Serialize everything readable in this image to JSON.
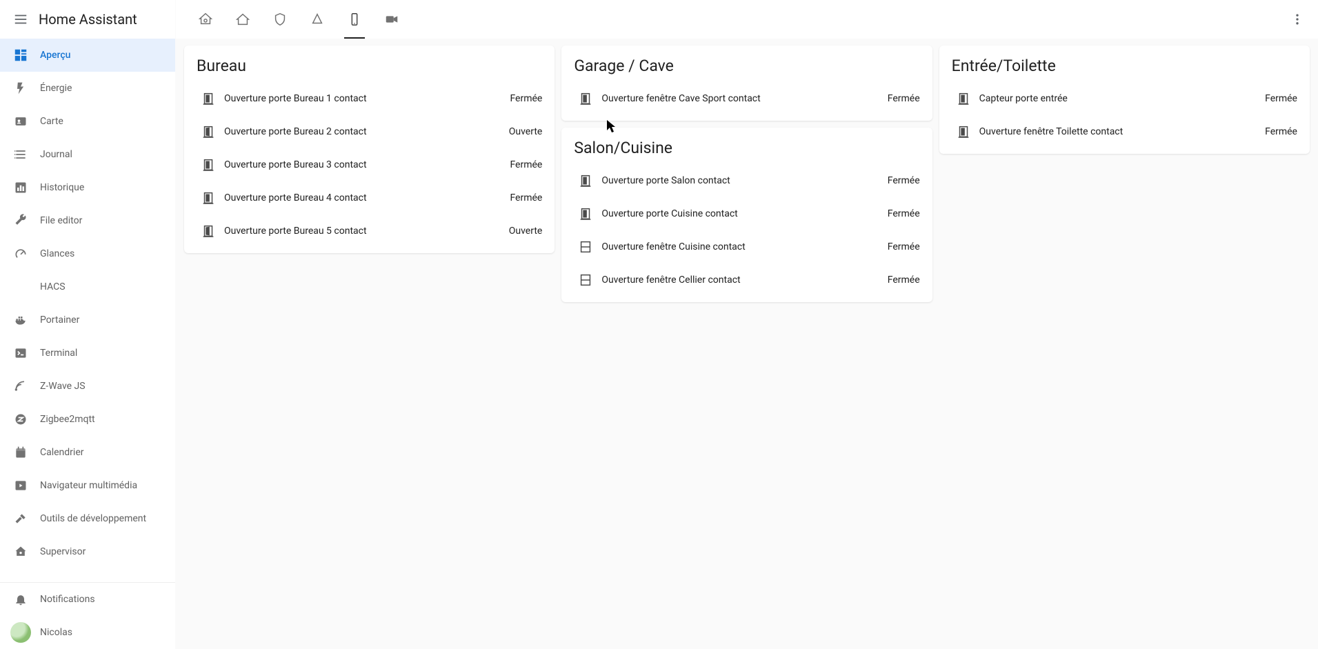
{
  "app": {
    "title": "Home Assistant"
  },
  "sidebar": {
    "items": [
      {
        "label": "Aperçu",
        "icon": "dashboard",
        "active": true
      },
      {
        "label": "Énergie",
        "icon": "flash"
      },
      {
        "label": "Carte",
        "icon": "account-card"
      },
      {
        "label": "Journal",
        "icon": "list"
      },
      {
        "label": "Historique",
        "icon": "chart"
      },
      {
        "label": "File editor",
        "icon": "wrench"
      },
      {
        "label": "Glances",
        "icon": "gauge"
      },
      {
        "label": "HACS",
        "icon": "none"
      },
      {
        "label": "Portainer",
        "icon": "docker"
      },
      {
        "label": "Terminal",
        "icon": "console"
      },
      {
        "label": "Z-Wave JS",
        "icon": "zwave"
      },
      {
        "label": "Zigbee2mqtt",
        "icon": "zigbee"
      },
      {
        "label": "Calendrier",
        "icon": "calendar"
      },
      {
        "label": "Navigateur multimédia",
        "icon": "play-box"
      },
      {
        "label": "Outils de développement",
        "icon": "hammer"
      },
      {
        "label": "Supervisor",
        "icon": "ha"
      }
    ],
    "notifications_label": "Notifications",
    "user_name": "Nicolas"
  },
  "cards": [
    {
      "title": "Bureau",
      "rows": [
        {
          "icon": "door",
          "name": "Ouverture porte Bureau 1 contact",
          "state": "Fermée"
        },
        {
          "icon": "door-open",
          "name": "Ouverture porte Bureau 2 contact",
          "state": "Ouverte"
        },
        {
          "icon": "door",
          "name": "Ouverture porte Bureau 3 contact",
          "state": "Fermée"
        },
        {
          "icon": "door",
          "name": "Ouverture porte Bureau 4 contact",
          "state": "Fermée"
        },
        {
          "icon": "door-open",
          "name": "Ouverture porte Bureau 5 contact",
          "state": "Ouverte"
        }
      ]
    },
    {
      "title": "Garage / Cave",
      "rows": [
        {
          "icon": "door",
          "name": "Ouverture fenêtre Cave Sport contact",
          "state": "Fermée"
        }
      ]
    },
    {
      "title": "Salon/Cuisine",
      "rows": [
        {
          "icon": "door",
          "name": "Ouverture porte Salon contact",
          "state": "Fermée"
        },
        {
          "icon": "door",
          "name": "Ouverture porte Cuisine contact",
          "state": "Fermée"
        },
        {
          "icon": "window",
          "name": "Ouverture fenêtre Cuisine contact",
          "state": "Fermée"
        },
        {
          "icon": "window",
          "name": "Ouverture fenêtre Cellier contact",
          "state": "Fermée"
        }
      ]
    },
    {
      "title": "Entrée/Toilette",
      "rows": [
        {
          "icon": "door",
          "name": "Capteur porte entrée",
          "state": "Fermée"
        },
        {
          "icon": "door",
          "name": "Ouverture fenêtre Toilette contact",
          "state": "Fermée"
        }
      ]
    }
  ]
}
